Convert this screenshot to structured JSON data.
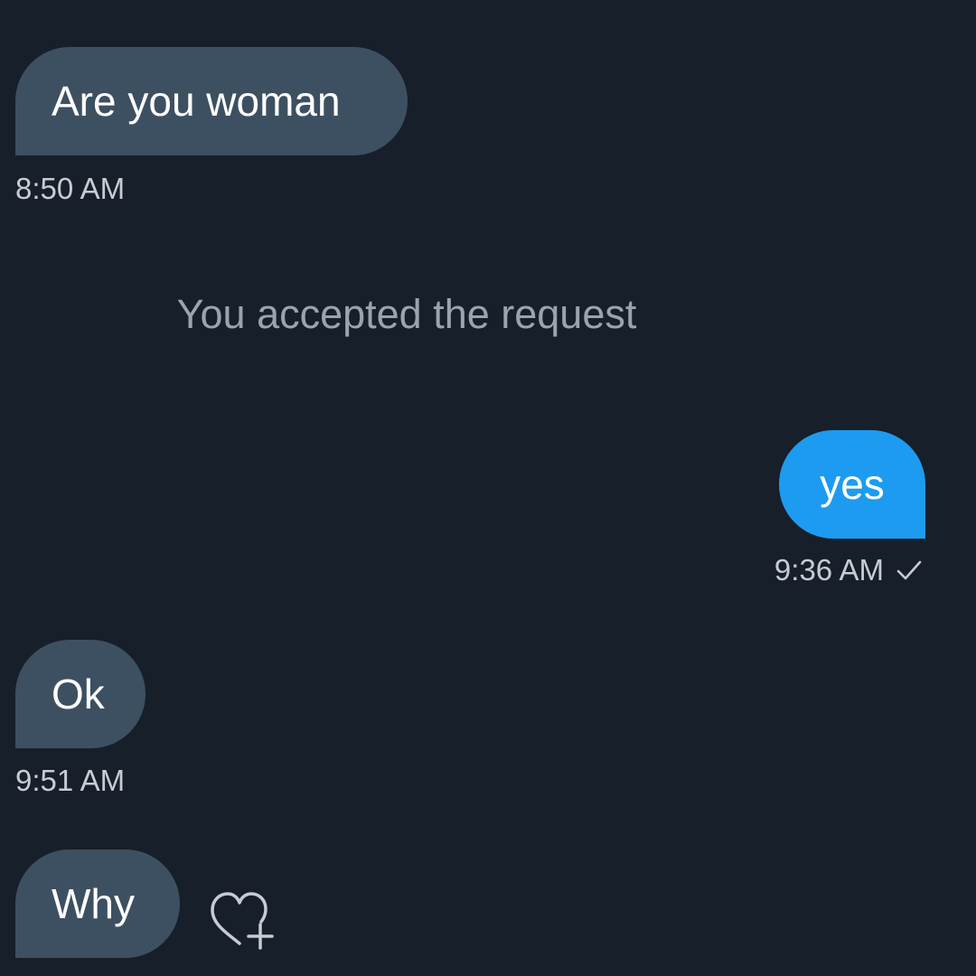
{
  "messages": [
    {
      "direction": "incoming",
      "text": "Are you woman",
      "time": "8:50 AM"
    },
    {
      "direction": "system",
      "text": "You accepted the request"
    },
    {
      "direction": "outgoing",
      "text": "yes",
      "time": "9:36 AM",
      "status_icon": "check-icon"
    },
    {
      "direction": "incoming",
      "text": "Ok",
      "time": "9:51 AM"
    },
    {
      "direction": "incoming",
      "text": "Why",
      "reaction_icon": "heart-plus-icon"
    }
  ],
  "colors": {
    "background": "#171f2a",
    "incoming_bubble": "#3d5061",
    "outgoing_bubble": "#1d9bf0",
    "timestamp": "#c7ccd2",
    "system_text": "#9aa4ae"
  }
}
